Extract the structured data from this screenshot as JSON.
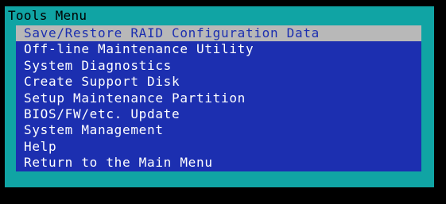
{
  "window": {
    "title": "Tools Menu"
  },
  "menu": {
    "selected_index": 0,
    "items": [
      {
        "label": "Save/Restore RAID Configuration Data"
      },
      {
        "label": "Off-line Maintenance Utility"
      },
      {
        "label": "System Diagnostics"
      },
      {
        "label": "Create Support Disk"
      },
      {
        "label": "Setup Maintenance Partition"
      },
      {
        "label": "BIOS/FW/etc. Update"
      },
      {
        "label": "System Management"
      },
      {
        "label": "Help"
      },
      {
        "label": "Return to the Main Menu"
      }
    ]
  },
  "colors": {
    "background": "#000000",
    "window_frame": "#10a4a4",
    "menu_panel": "#1c2fb0",
    "item_text": "#ffffff",
    "selected_bg": "#b8b8b8",
    "selected_text": "#1c2fb0"
  }
}
